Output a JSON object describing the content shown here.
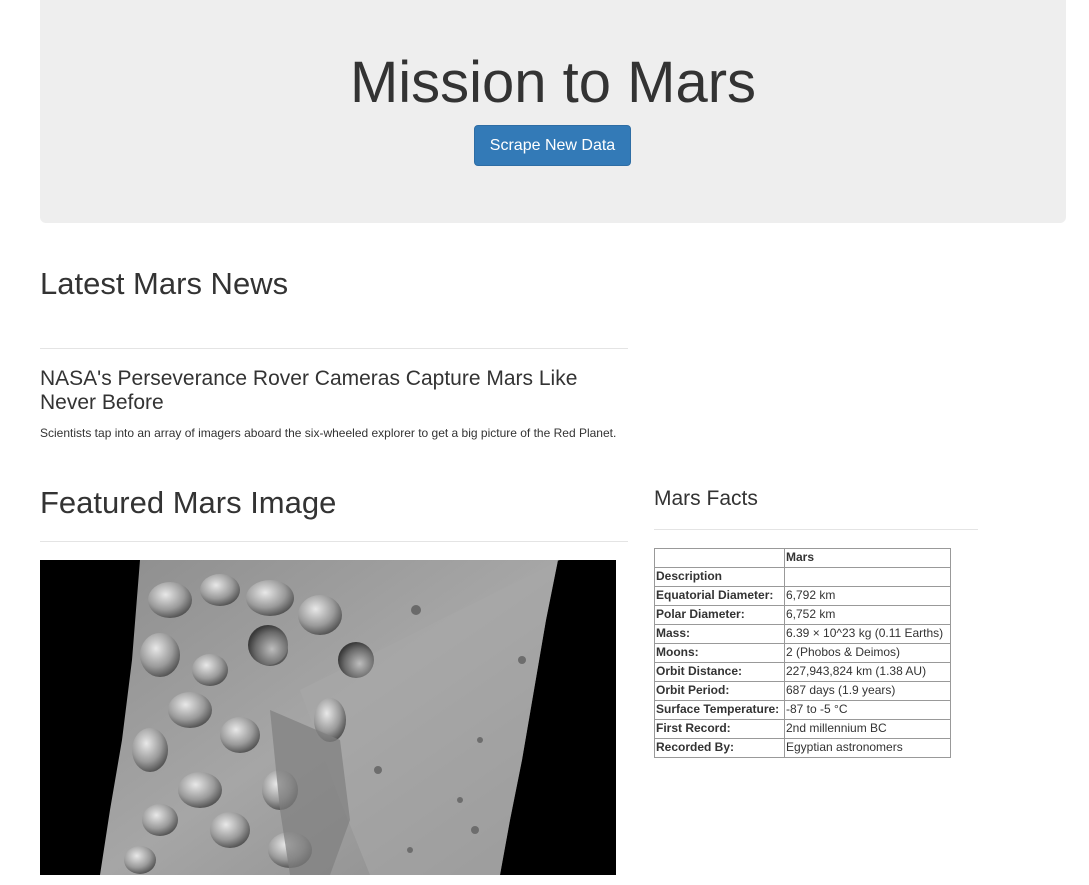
{
  "header": {
    "title": "Mission to Mars",
    "scrape_button": "Scrape New Data"
  },
  "news": {
    "heading": "Latest Mars News",
    "title": "NASA's Perseverance Rover Cameras Capture Mars Like Never Before",
    "teaser": "Scientists tap into an array of imagers aboard the six-wheeled explorer to get a big picture of the Red Planet."
  },
  "featured": {
    "heading": "Featured Mars Image"
  },
  "facts": {
    "heading": "Mars Facts",
    "column_header": "Mars",
    "rows": [
      {
        "label": "Description",
        "value": ""
      },
      {
        "label": "Equatorial Diameter:",
        "value": "6,792 km"
      },
      {
        "label": "Polar Diameter:",
        "value": "6,752 km"
      },
      {
        "label": "Mass:",
        "value": "6.39 × 10^23 kg (0.11 Earths)"
      },
      {
        "label": "Moons:",
        "value": "2 (Phobos & Deimos)"
      },
      {
        "label": "Orbit Distance:",
        "value": "227,943,824 km (1.38 AU)"
      },
      {
        "label": "Orbit Period:",
        "value": "687 days (1.9 years)"
      },
      {
        "label": "Surface Temperature:",
        "value": "-87 to -5 °C"
      },
      {
        "label": "First Record:",
        "value": "2nd millennium BC"
      },
      {
        "label": "Recorded By:",
        "value": "Egyptian astronomers"
      }
    ]
  }
}
